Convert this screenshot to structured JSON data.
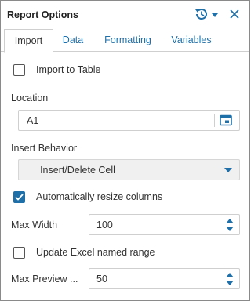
{
  "panel": {
    "title": "Report Options",
    "icons": {
      "history": "history-icon",
      "dropdown": "chevron-down-icon",
      "close": "close-icon"
    },
    "accent_color": "#1f6fa8"
  },
  "tabs": [
    {
      "label": "Import",
      "active": true
    },
    {
      "label": "Data",
      "active": false
    },
    {
      "label": "Formatting",
      "active": false
    },
    {
      "label": "Variables",
      "active": false
    }
  ],
  "import": {
    "import_to_table": {
      "label": "Import to Table",
      "checked": false
    },
    "location": {
      "label": "Location",
      "value": "A1",
      "icon": "cell-picker-icon"
    },
    "insert_behavior": {
      "label": "Insert Behavior",
      "value": "Insert/Delete Cell"
    },
    "auto_resize": {
      "label": "Automatically resize columns",
      "checked": true
    },
    "max_width": {
      "label": "Max Width",
      "value": "100"
    },
    "update_named_range": {
      "label": "Update Excel named range",
      "checked": false
    },
    "max_preview": {
      "label": "Max Preview ...",
      "value": "50"
    }
  }
}
